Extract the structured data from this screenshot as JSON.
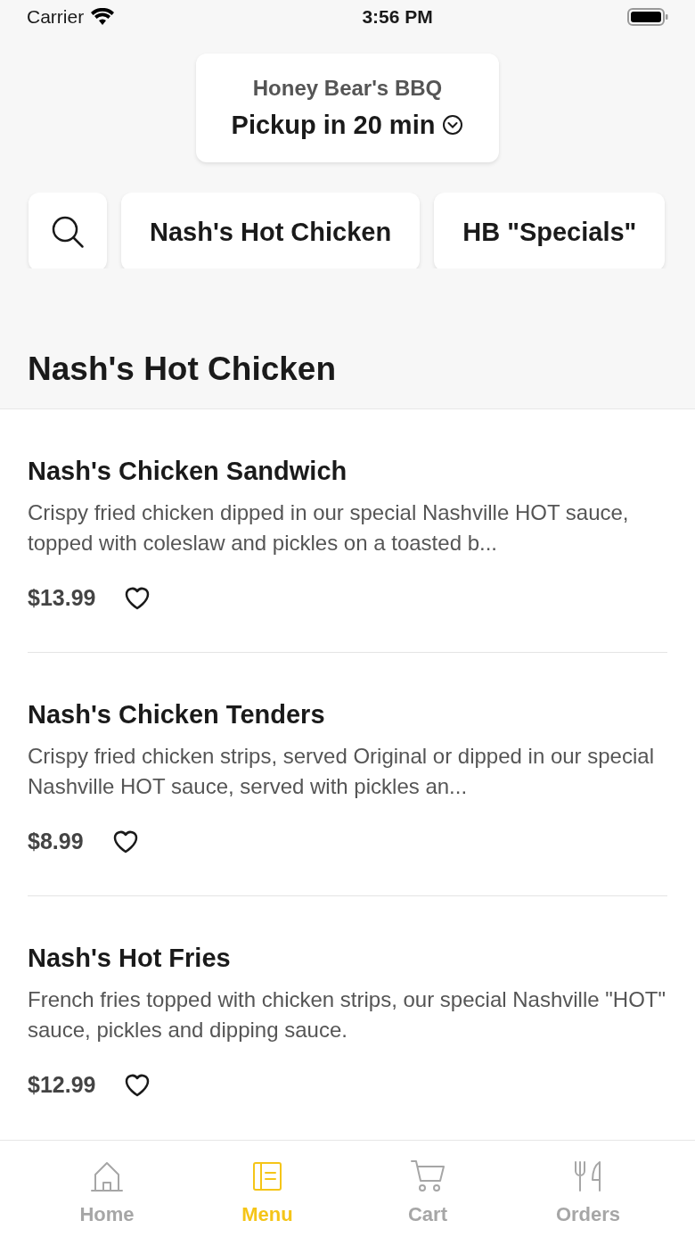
{
  "status_bar": {
    "carrier": "Carrier",
    "time": "3:56 PM"
  },
  "header": {
    "restaurant": "Honey Bear's BBQ",
    "pickup": "Pickup in 20 min"
  },
  "categories": [
    "Nash's Hot Chicken",
    "HB \"Specials\""
  ],
  "section": {
    "title": "Nash's Hot Chicken"
  },
  "items": [
    {
      "name": "Nash's Chicken Sandwich",
      "description": "Crispy fried chicken dipped in our special Nashville HOT sauce, topped with coleslaw and pickles on a toasted b...",
      "price": "$13.99",
      "favorite": false
    },
    {
      "name": "Nash's Chicken Tenders",
      "description": "Crispy fried chicken strips, served Original or dipped in our special Nashville HOT sauce, served with pickles an...",
      "price": "$8.99",
      "favorite": false
    },
    {
      "name": "Nash's Hot Fries",
      "description": "French fries topped with chicken strips, our special Nashville \"HOT\" sauce, pickles and dipping sauce.",
      "price": "$12.99",
      "favorite": false
    }
  ],
  "tab_bar": [
    {
      "kind": "home",
      "label": "Home",
      "selected": false
    },
    {
      "kind": "menu",
      "label": "Menu",
      "selected": true
    },
    {
      "kind": "cart",
      "label": "Cart",
      "selected": false
    },
    {
      "kind": "orders",
      "label": "Orders",
      "selected": false
    }
  ]
}
